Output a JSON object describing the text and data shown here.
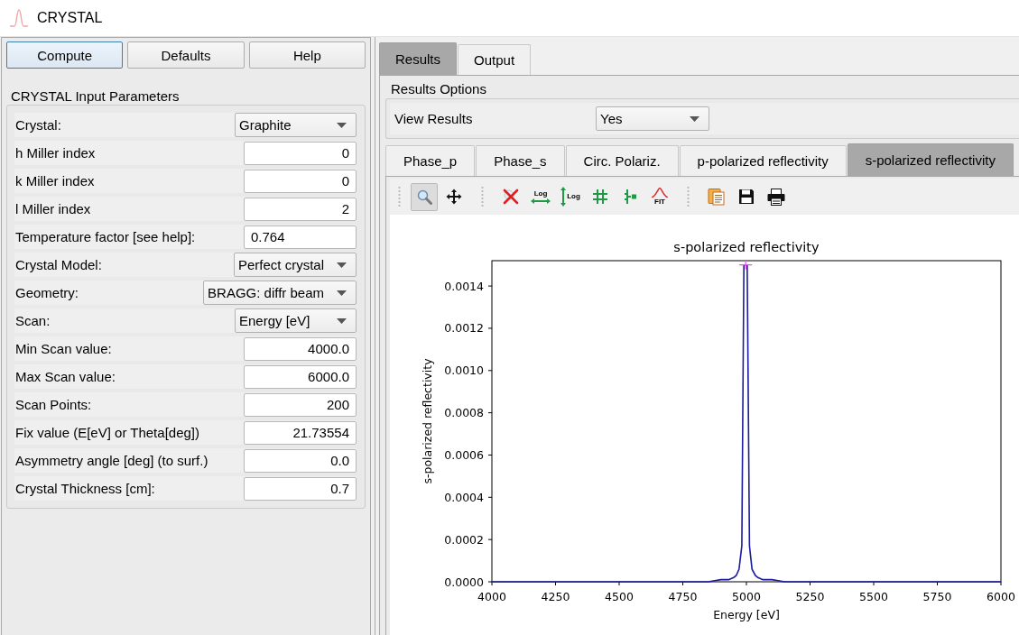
{
  "window": {
    "title": "CRYSTAL"
  },
  "actions": [
    {
      "label": "Compute",
      "focused": true
    },
    {
      "label": "Defaults",
      "focused": false
    },
    {
      "label": "Help",
      "focused": false
    }
  ],
  "parameters": {
    "title": "CRYSTAL Input Parameters",
    "rows": [
      {
        "label": "Crystal:",
        "kind": "combo",
        "value": "Graphite"
      },
      {
        "label": "h Miller index",
        "kind": "number",
        "value": "0"
      },
      {
        "label": "k Miller index",
        "kind": "number",
        "value": "0"
      },
      {
        "label": "l Miller index",
        "kind": "number",
        "value": "2"
      },
      {
        "label": "Temperature factor [see help]:",
        "kind": "text",
        "value": "0.764"
      },
      {
        "label": "Crystal Model:",
        "kind": "combo",
        "value": "Perfect crystal"
      },
      {
        "label": "Geometry:",
        "kind": "combo",
        "value": "BRAGG: diffr beam"
      },
      {
        "label": "Scan:",
        "kind": "combo",
        "value": "Energy [eV]"
      },
      {
        "label": "Min Scan value:",
        "kind": "number",
        "value": "4000.0"
      },
      {
        "label": "Max Scan value:",
        "kind": "number",
        "value": "6000.0"
      },
      {
        "label": "Scan Points:",
        "kind": "number",
        "value": "200"
      },
      {
        "label": "Fix value (E[eV] or Theta[deg])",
        "kind": "number",
        "value": "21.73554"
      },
      {
        "label": "Asymmetry angle [deg] (to surf.)",
        "kind": "number",
        "value": "0.0"
      },
      {
        "label": "Crystal Thickness [cm]:",
        "kind": "number",
        "value": "0.7"
      }
    ]
  },
  "main_tabs": [
    {
      "label": "Results",
      "selected": true
    },
    {
      "label": "Output",
      "selected": false
    }
  ],
  "results_options": {
    "title": "Results Options",
    "label": "View Results",
    "value": "Yes"
  },
  "plot_tabs": [
    {
      "label": "Phase_p",
      "selected": false
    },
    {
      "label": "Phase_s",
      "selected": false
    },
    {
      "label": "Circ. Polariz.",
      "selected": false
    },
    {
      "label": "p-polarized reflectivity",
      "selected": false
    },
    {
      "label": "s-polarized reflectivity",
      "selected": true
    }
  ],
  "plot_toolbar": [
    {
      "items": [
        {
          "kind": "zoom",
          "selected": true
        },
        {
          "kind": "pan",
          "selected": false
        }
      ]
    },
    {
      "items": [
        {
          "kind": "clear",
          "selected": false
        },
        {
          "kind": "log-x",
          "text": "Log",
          "selected": false
        },
        {
          "kind": "log-y",
          "text": "Log",
          "selected": false
        },
        {
          "kind": "grid",
          "selected": false
        },
        {
          "kind": "marker",
          "selected": false
        },
        {
          "kind": "fit",
          "text": "FIT",
          "selected": false
        }
      ]
    },
    {
      "items": [
        {
          "kind": "copy",
          "selected": false
        },
        {
          "kind": "save",
          "selected": false
        },
        {
          "kind": "print",
          "selected": false
        }
      ]
    }
  ],
  "plot": {
    "chart_data": {
      "type": "line",
      "title": "s-polarized reflectivity",
      "xlabel": "Energy [eV]",
      "ylabel": "s-polarized reflectivity",
      "x": [
        4000,
        4250,
        4500,
        4750,
        4800,
        4850,
        4900,
        4930,
        4950,
        4960,
        4971,
        4982,
        4990,
        4997,
        5003,
        5012,
        5022,
        5035,
        5045,
        5065,
        5100,
        5150,
        5200,
        5250,
        5500,
        5750,
        6000
      ],
      "series": [
        {
          "color": "#1c1c9c",
          "values": [
            0,
            0,
            0,
            0,
            0,
            0,
            1e-05,
            1e-05,
            2e-05,
            3e-05,
            6e-05,
            0.00017,
            0.0015,
            0.0015,
            0.0015,
            0.00017,
            6e-05,
            3e-05,
            2e-05,
            1e-05,
            1e-05,
            0,
            0,
            0,
            0,
            0,
            0
          ]
        },
        {
          "type": "scatter",
          "color": "#ff44ff",
          "marker": "+",
          "values": [
            null,
            null,
            null,
            null,
            null,
            null,
            null,
            null,
            null,
            null,
            null,
            null,
            null,
            0.0015,
            null,
            null,
            null,
            null,
            null,
            null,
            null,
            null,
            null,
            null,
            null,
            null,
            null
          ]
        }
      ],
      "xlim": [
        4000,
        6000
      ],
      "ylim": [
        0,
        0.00152
      ],
      "xticks": [
        4000,
        4250,
        4500,
        4750,
        5000,
        5250,
        5500,
        5750,
        6000
      ],
      "yticks": [
        {
          "value": 0,
          "label": "0.0000"
        },
        {
          "value": 0.0002,
          "label": "0.0002"
        },
        {
          "value": 0.0004,
          "label": "0.0004"
        },
        {
          "value": 0.0006,
          "label": "0.0006"
        },
        {
          "value": 0.0008,
          "label": "0.0008"
        },
        {
          "value": 0.001,
          "label": "0.0010"
        },
        {
          "value": 0.0012,
          "label": "0.0012"
        },
        {
          "value": 0.0014,
          "label": "0.0014"
        }
      ]
    }
  }
}
